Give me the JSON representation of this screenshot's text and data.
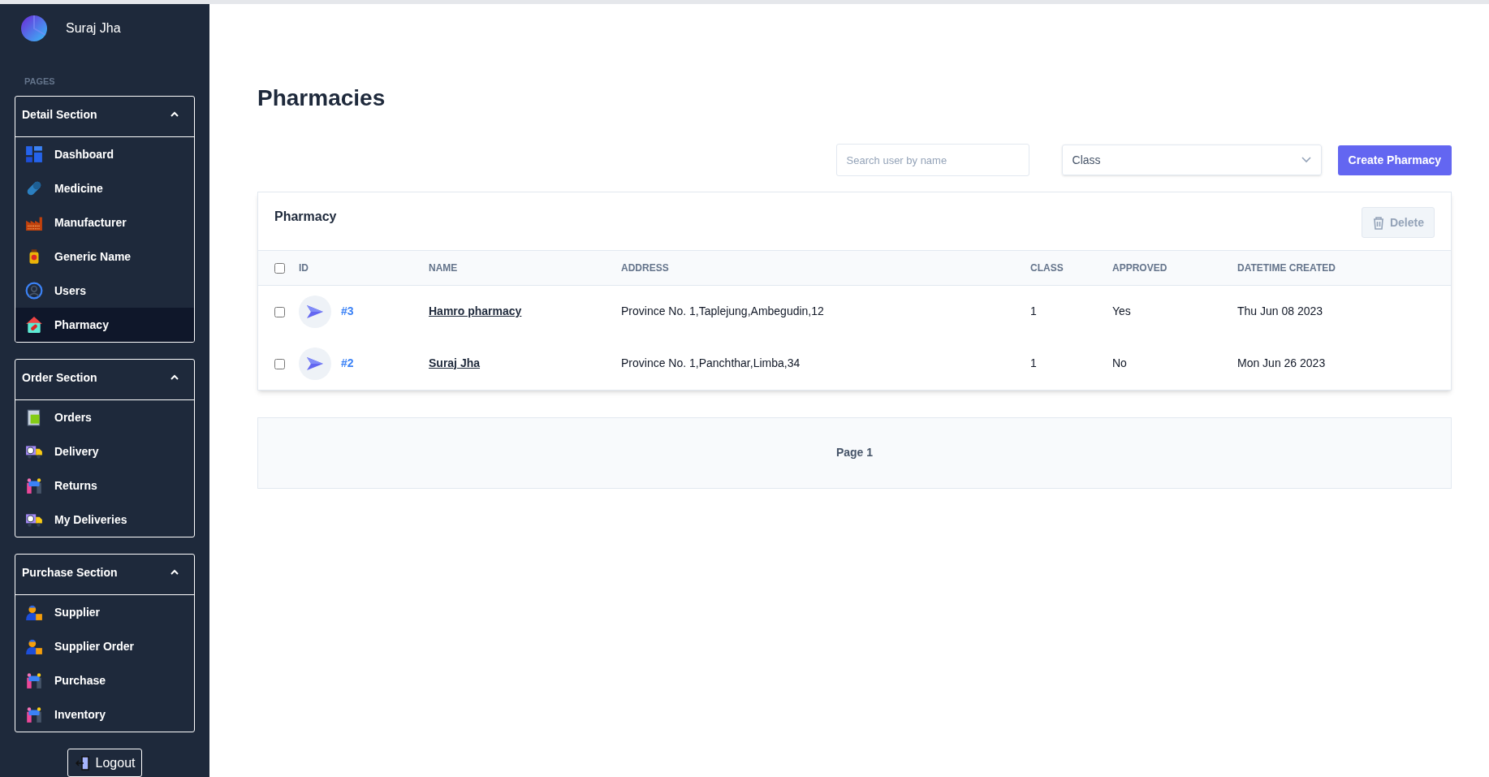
{
  "user": {
    "name": "Suraj Jha"
  },
  "sidebar": {
    "heading": "PAGES",
    "sections": [
      {
        "title": "Detail Section",
        "expanded": true,
        "items": [
          {
            "label": "Dashboard",
            "selected": false
          },
          {
            "label": "Medicine",
            "selected": false
          },
          {
            "label": "Manufacturer",
            "selected": false
          },
          {
            "label": "Generic Name",
            "selected": false
          },
          {
            "label": "Users",
            "selected": false
          },
          {
            "label": "Pharmacy",
            "selected": true
          }
        ]
      },
      {
        "title": "Order Section",
        "expanded": true,
        "items": [
          {
            "label": "Orders",
            "selected": false
          },
          {
            "label": "Delivery",
            "selected": false
          },
          {
            "label": "Returns",
            "selected": false
          },
          {
            "label": "My Deliveries",
            "selected": false
          }
        ]
      },
      {
        "title": "Purchase Section",
        "expanded": true,
        "items": [
          {
            "label": "Supplier",
            "selected": false
          },
          {
            "label": "Supplier Order",
            "selected": false
          },
          {
            "label": "Purchase",
            "selected": false
          },
          {
            "label": "Inventory",
            "selected": false
          }
        ]
      }
    ],
    "logout": "Logout"
  },
  "page": {
    "title": "Pharmacies"
  },
  "toolbar": {
    "search": {
      "placeholder": "Search user by name"
    },
    "class_select": {
      "value": "Class"
    },
    "create_button": "Create Pharmacy"
  },
  "table": {
    "title": "Pharmacy",
    "delete_button": {
      "label": "Delete",
      "disabled": true
    },
    "select_all": {
      "checked": false
    },
    "columns": [
      "ID",
      "NAME",
      "ADDRESS",
      "CLASS",
      "APPROVED",
      "DATETIME CREATED"
    ],
    "rows": [
      {
        "checked": false,
        "id": "#3",
        "name": "Hamro pharmacy",
        "address": "Province No. 1,Taplejung,Ambegudin,12",
        "class": "1",
        "approved": "Yes",
        "created": "Thu Jun 08 2023"
      },
      {
        "checked": false,
        "id": "#2",
        "name": "Suraj Jha",
        "address": "Province No. 1,Panchthar,Limba,34",
        "class": "1",
        "approved": "No",
        "created": "Mon Jun 26 2023"
      }
    ]
  },
  "pagination": {
    "label": "Page 1"
  }
}
